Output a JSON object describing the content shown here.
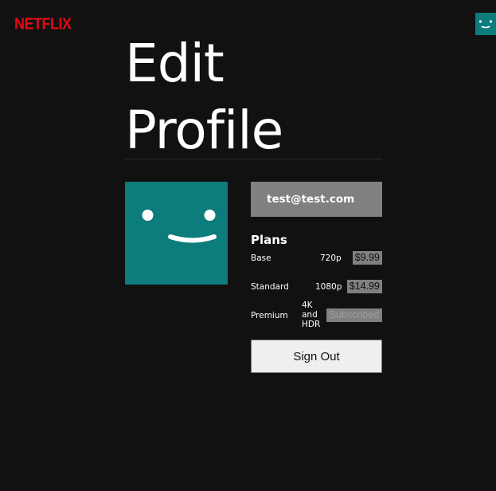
{
  "header": {
    "logo_text": "NETFLIX",
    "avatar_icon": "smiley-face-icon"
  },
  "page": {
    "title_line1": "Edit",
    "title_line2": "Profile"
  },
  "profile": {
    "avatar_icon": "smiley-face-icon",
    "avatar_color": "#0c7c7c",
    "email": "test@test.com"
  },
  "plans": {
    "heading": "Plans",
    "items": [
      {
        "name": "Base",
        "resolution": "720p",
        "price": "$9.99"
      },
      {
        "name": "Standard",
        "resolution": "1080p",
        "price": "$14.99"
      },
      {
        "name": "Premium",
        "resolution_lines": [
          "4K",
          "and",
          "HDR"
        ],
        "price": "Subscribed"
      }
    ]
  },
  "actions": {
    "sign_out_label": "Sign Out"
  },
  "colors": {
    "background": "#111111",
    "brand": "#e50914",
    "avatar": "#0c7c7c",
    "email_box": "#808080"
  }
}
